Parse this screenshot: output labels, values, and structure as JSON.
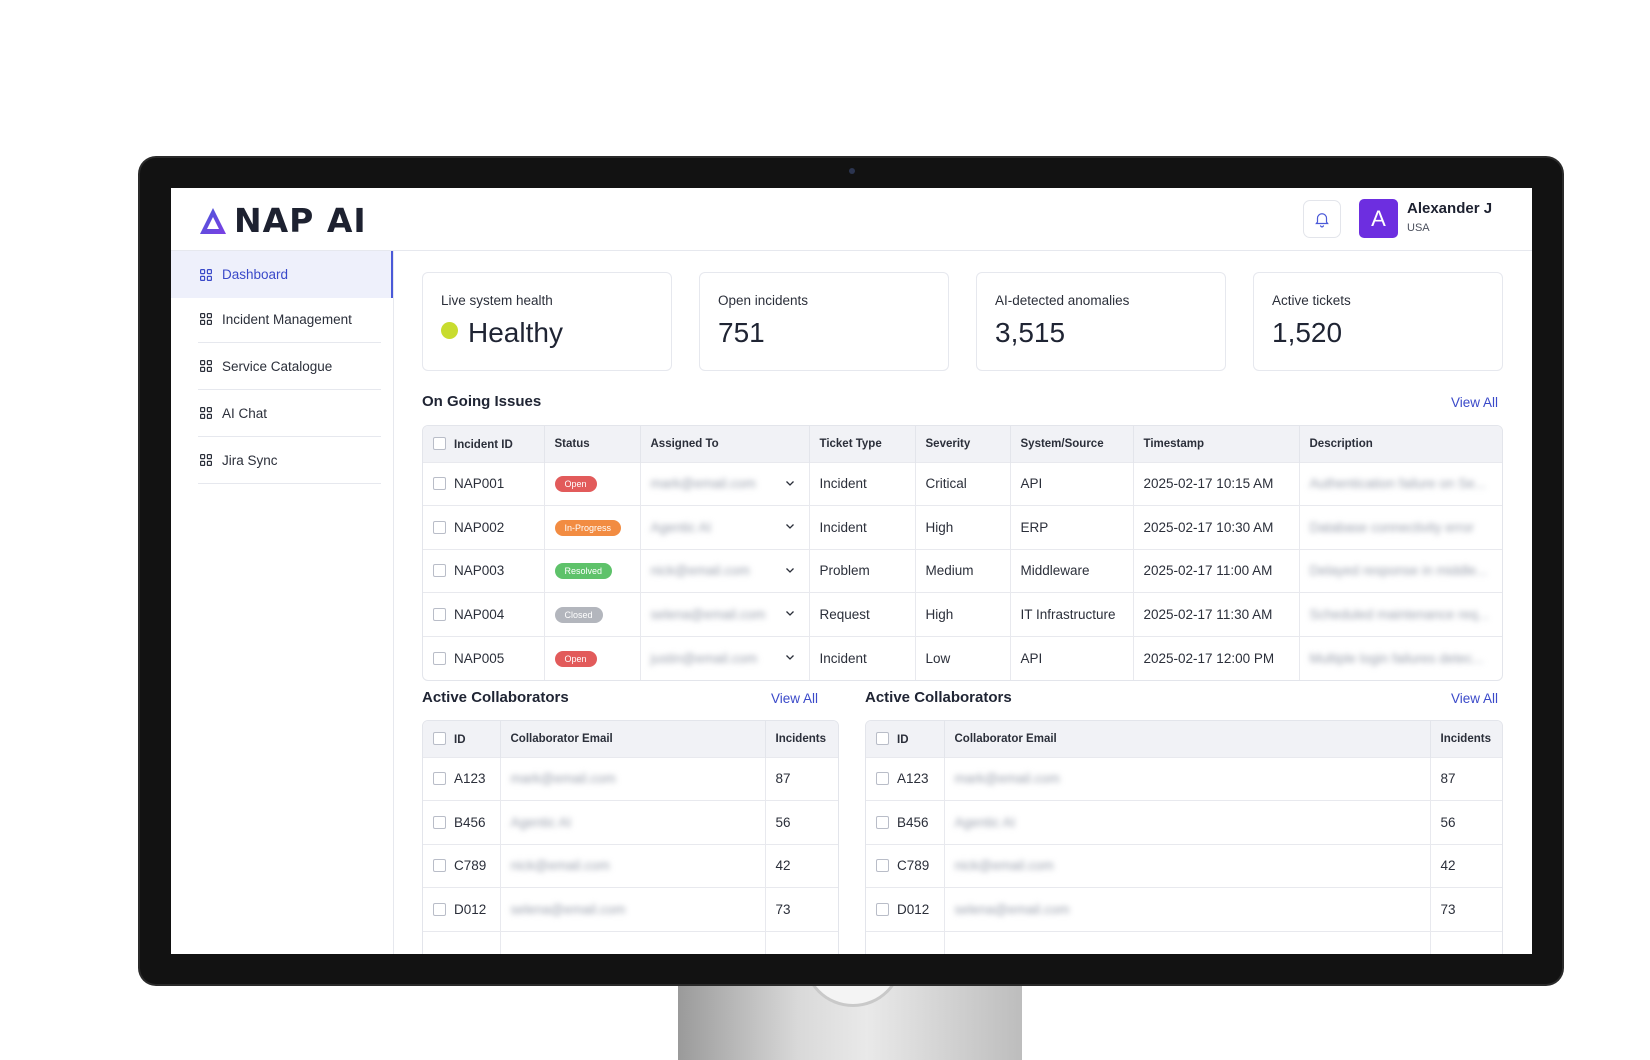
{
  "brand": {
    "name": "NAP AI"
  },
  "user": {
    "initial": "A",
    "name": "Alexander J",
    "country": "USA"
  },
  "sidebar": {
    "items": [
      {
        "label": "Dashboard",
        "active": true
      },
      {
        "label": "Incident Management"
      },
      {
        "label": "Service Catalogue"
      },
      {
        "label": "AI Chat"
      },
      {
        "label": "Jira Sync"
      }
    ]
  },
  "stats": [
    {
      "label": "Live system health",
      "value": "Healthy"
    },
    {
      "label": "Open incidents",
      "value": "751"
    },
    {
      "label": "AI-detected anomalies",
      "value": "3,515"
    },
    {
      "label": "Active tickets",
      "value": "1,520"
    }
  ],
  "ongoing": {
    "title": "On Going Issues",
    "view_all": "View All",
    "columns": [
      "Incident ID",
      "Status",
      "Assigned To",
      "Ticket Type",
      "Severity",
      "System/Source",
      "Timestamp",
      "Description"
    ],
    "rows": [
      {
        "id": "NAP001",
        "status": "Open",
        "assigned": "mark@email.com",
        "type": "Incident",
        "severity": "Critical",
        "source": "API",
        "timestamp": "2025-02-17 10:15 AM",
        "description": "Authentication failure on Se..."
      },
      {
        "id": "NAP002",
        "status": "In-Progress",
        "assigned": "Agentic AI",
        "type": "Incident",
        "severity": "High",
        "source": "ERP",
        "timestamp": "2025-02-17 10:30 AM",
        "description": "Database connectivity error"
      },
      {
        "id": "NAP003",
        "status": "Resolved",
        "assigned": "nick@email.com",
        "type": "Problem",
        "severity": "Medium",
        "source": "Middleware",
        "timestamp": "2025-02-17 11:00 AM",
        "description": "Delayed response in middle..."
      },
      {
        "id": "NAP004",
        "status": "Closed",
        "assigned": "selena@email.com",
        "type": "Request",
        "severity": "High",
        "source": "IT Infrastructure",
        "timestamp": "2025-02-17 11:30 AM",
        "description": "Scheduled maintenance req..."
      },
      {
        "id": "NAP005",
        "status": "Open",
        "assigned": "justin@email.com",
        "type": "Incident",
        "severity": "Low",
        "source": "API",
        "timestamp": "2025-02-17 12:00 PM",
        "description": "Multiple login failures detec..."
      }
    ]
  },
  "collaborators_left": {
    "title": "Active Collaborators",
    "view_all": "View All",
    "columns": [
      "ID",
      "Collaborator Email",
      "Incidents"
    ],
    "rows": [
      {
        "id": "A123",
        "email": "mark@email.com",
        "incidents": "87"
      },
      {
        "id": "B456",
        "email": "Agentic AI",
        "incidents": "56"
      },
      {
        "id": "C789",
        "email": "nick@email.com",
        "incidents": "42"
      },
      {
        "id": "D012",
        "email": "selena@email.com",
        "incidents": "73"
      }
    ]
  },
  "collaborators_right": {
    "title": "Active Collaborators",
    "view_all": "View All",
    "columns": [
      "ID",
      "Collaborator Email",
      "Incidents"
    ],
    "rows": [
      {
        "id": "A123",
        "email": "mark@email.com",
        "incidents": "87"
      },
      {
        "id": "B456",
        "email": "Agentic AI",
        "incidents": "56"
      },
      {
        "id": "C789",
        "email": "nick@email.com",
        "incidents": "42"
      },
      {
        "id": "D012",
        "email": "selena@email.com",
        "incidents": "73"
      }
    ]
  },
  "colors": {
    "accent": "#4a59d8",
    "avatar": "#6d2ee0",
    "health": "#c8dc2f",
    "status_open": "#e25b5b",
    "status_in_progress": "#f28c42",
    "status_resolved": "#5ec26a",
    "status_closed": "#b3b6bd"
  }
}
